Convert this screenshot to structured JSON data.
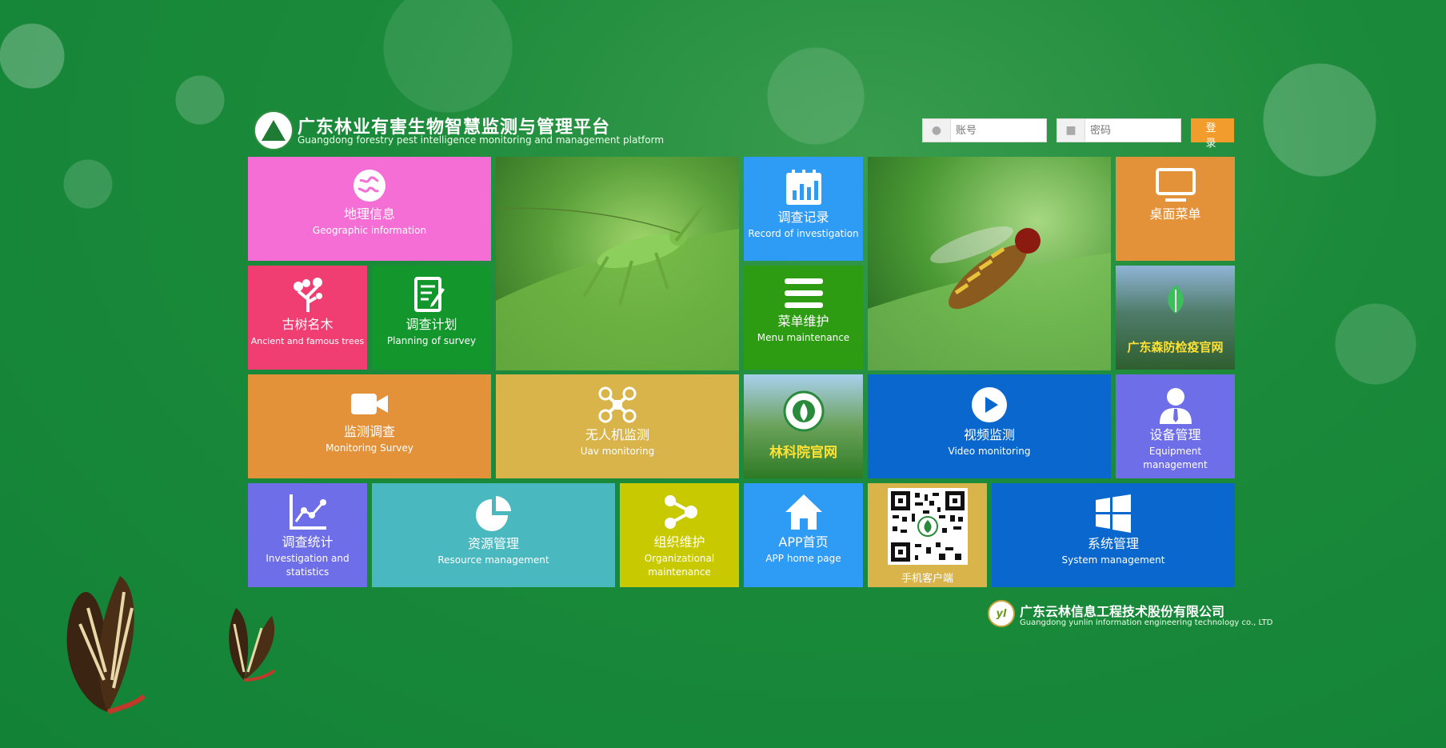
{
  "header": {
    "title_cn": "广东林业有害生物智慧监测与管理平台",
    "title_en": "Guangdong forestry pest intelligence monitoring and management platform"
  },
  "login": {
    "account_placeholder": "账号",
    "password_placeholder": "密码",
    "login_label": "登 录"
  },
  "tiles": {
    "geo": {
      "cn": "地理信息",
      "en": "Geographic information"
    },
    "ancient": {
      "cn": "古树名木",
      "en": "Ancient and famous trees"
    },
    "plan": {
      "cn": "调查计划",
      "en": "Planning of survey"
    },
    "record": {
      "cn": "调查记录",
      "en": "Record of investigation"
    },
    "menu": {
      "cn": "菜单维护",
      "en": "Menu maintenance"
    },
    "desktop": {
      "cn": "桌面菜单"
    },
    "forest_quarantine": {
      "cn": "广东森防检疫官网"
    },
    "monitor": {
      "cn": "监测调查",
      "en": "Monitoring Survey"
    },
    "uav": {
      "cn": "无人机监测",
      "en": "Uav monitoring"
    },
    "academy": {
      "cn": "林科院官网"
    },
    "video": {
      "cn": "视频监测",
      "en": "Video monitoring"
    },
    "equipment": {
      "cn": "设备管理",
      "en": "Equipment management"
    },
    "stats": {
      "cn": "调查统计",
      "en": "Investigation and statistics"
    },
    "resource": {
      "cn": "资源管理",
      "en": "Resource management"
    },
    "org": {
      "cn": "组织维护",
      "en": "Organizational maintenance"
    },
    "app": {
      "cn": "APP首页",
      "en": "APP home page"
    },
    "mobile": {
      "cn": "手机客户端"
    },
    "system": {
      "cn": "系统管理",
      "en": "System management"
    }
  },
  "footer": {
    "logo_text": "yl",
    "company_cn": "广东云林信息工程技术股份有限公司",
    "company_en": "Guangdong yunlin information engineering technology co., LTD"
  },
  "colors": {
    "pink": "#f56ed6",
    "red": "#f03e73",
    "green": "#13962c",
    "blue": "#2e9bf5",
    "dark_green": "#2d9c12",
    "orange": "#e4923a",
    "gold": "#d8b44a",
    "royal_blue": "#0a67cd",
    "purple": "#6e6ee8",
    "teal": "#4ab8bf",
    "lime": "#c9c900",
    "login_orange": "#f29c2c"
  }
}
